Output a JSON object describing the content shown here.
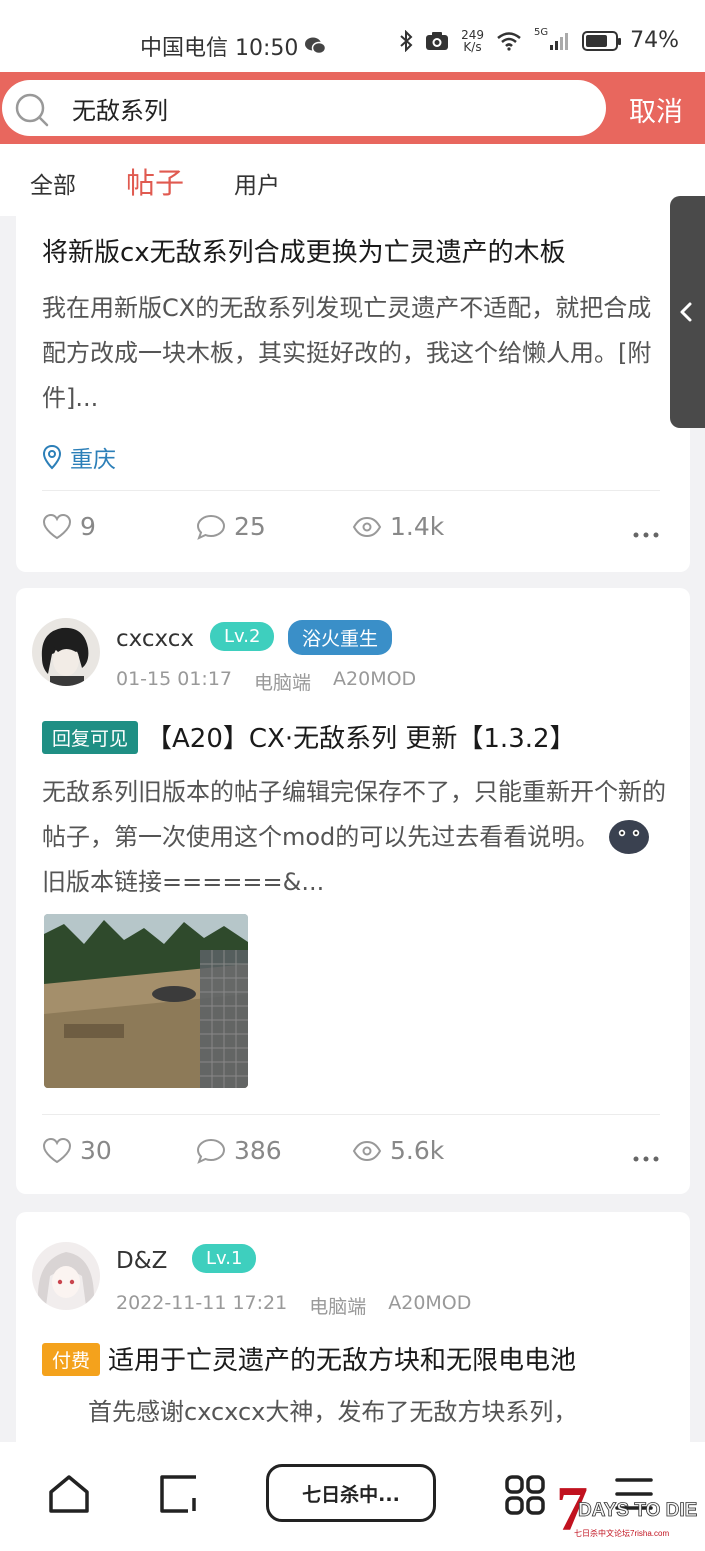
{
  "status_bar": {
    "carrier_time": "中国电信 10:50",
    "net_speed_top": "249",
    "net_speed_bottom": "K/s",
    "signal_label": "5G",
    "battery": "74%",
    "battery_level": 0.74
  },
  "search": {
    "query": "无敌系列",
    "cancel_label": "取消"
  },
  "tabs": [
    {
      "label": "全部",
      "active": false
    },
    {
      "label": "帖子",
      "active": true
    },
    {
      "label": "用户",
      "active": false
    }
  ],
  "posts": [
    {
      "title": "将新版cx无敌系列合成更换为亡灵遗产的木板",
      "excerpt": "我在用新版CX的无敌系列发现亡灵遗产不适配，就把合成配方改成一块木板，其实挺好改的，我这个给懒人用。[附件]...",
      "location": "重庆",
      "likes": "9",
      "comments": "25",
      "views": "1.4k"
    },
    {
      "username": "cxcxcx",
      "level": "Lv.2",
      "title_badge": "浴火重生",
      "date": "01-15 01:17",
      "platform": "电脑端",
      "category": "A20MOD",
      "tag": "回复可见",
      "title": "【A20】CX·无敌系列 更新【1.3.2】",
      "excerpt_1": "无敌系列旧版本的帖子编辑完保存不了，只能重新开个新的帖子，第一次使用这个mod的可以先过去看看说明。",
      "excerpt_2": " 旧版本链接======&...",
      "likes": "30",
      "comments": "386",
      "views": "5.6k"
    },
    {
      "username": "D&Z",
      "level": "Lv.1",
      "date": "2022-11-11 17:21",
      "platform": "电脑端",
      "category": "A20MOD",
      "tag": "付费",
      "title": "适用于亡灵遗产的无敌方块和无限电电池",
      "excerpt": "首先感谢cxcxcx大神，发布了无敌方块系列，"
    }
  ],
  "bottom_nav": {
    "pill_label": "七日杀中..."
  },
  "watermark": {
    "text_main": "DAYS TO DIE",
    "numeral": "7",
    "text_sub": "七日杀中文论坛7risha.com"
  },
  "colors": {
    "header": "#e8675e",
    "active_tab": "#e05a50",
    "level_badge": "#3ecfbe",
    "title_badge": "#3a8fc8",
    "tag_reply": "#1f8f84",
    "tag_paid": "#f4a21c",
    "location": "#2c7fb8"
  }
}
